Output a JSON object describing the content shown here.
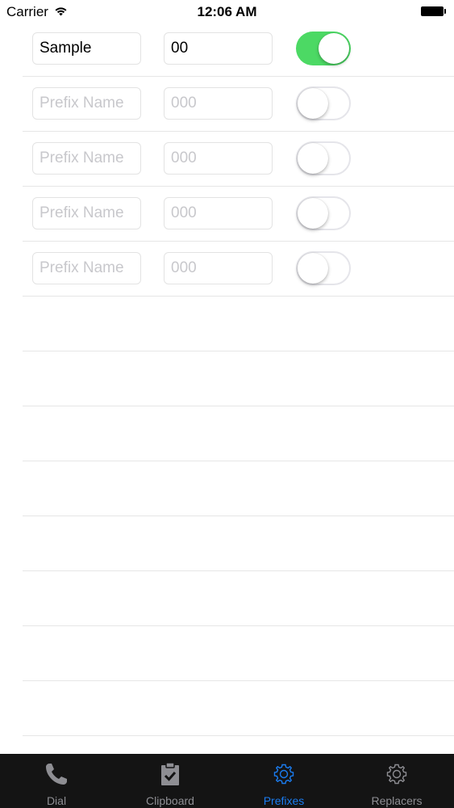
{
  "status_bar": {
    "carrier": "Carrier",
    "time": "12:06 AM"
  },
  "prefixes": [
    {
      "name": "Sample",
      "code": "00",
      "enabled": true
    },
    {
      "name": "",
      "code": "",
      "enabled": false
    },
    {
      "name": "",
      "code": "",
      "enabled": false
    },
    {
      "name": "",
      "code": "",
      "enabled": false
    },
    {
      "name": "",
      "code": "",
      "enabled": false
    }
  ],
  "placeholders": {
    "name": "Prefix Name",
    "code": "000"
  },
  "colors": {
    "switch_on": "#4cd964",
    "tab_active": "#1a7cf0",
    "tab_inactive": "#8e8e93",
    "tab_bar_bg": "#141414"
  },
  "tab_bar": {
    "tabs": [
      {
        "label": "Dial",
        "icon": "phone-icon",
        "active": false
      },
      {
        "label": "Clipboard",
        "icon": "clipboard-icon",
        "active": false
      },
      {
        "label": "Prefixes",
        "icon": "gear-icon",
        "active": true
      },
      {
        "label": "Replacers",
        "icon": "gear-icon",
        "active": false
      }
    ]
  }
}
